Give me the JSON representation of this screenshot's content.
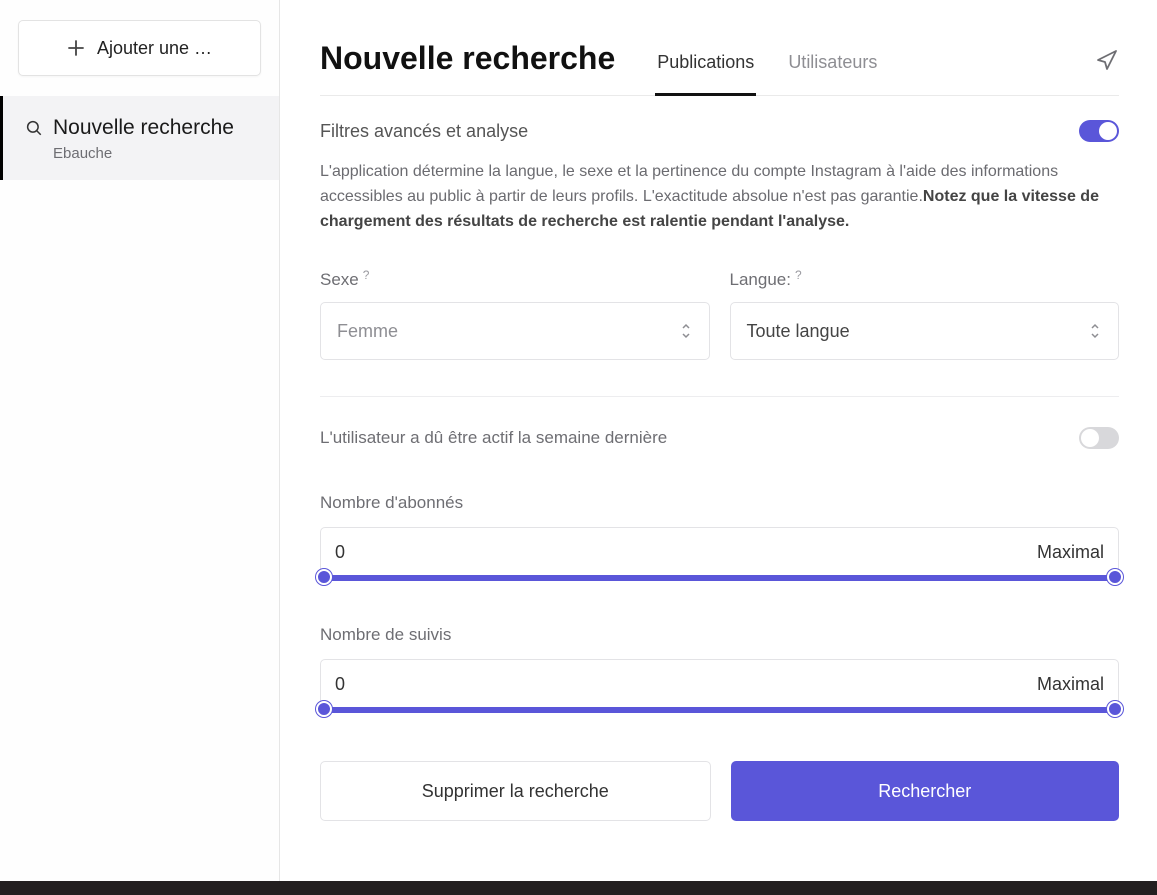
{
  "sidebar": {
    "add_label": "Ajouter une …",
    "item": {
      "title": "Nouvelle recherche",
      "subtitle": "Ebauche"
    }
  },
  "header": {
    "title": "Nouvelle recherche",
    "tabs": {
      "publications": "Publications",
      "users": "Utilisateurs"
    }
  },
  "filters": {
    "title": "Filtres avancés et analyse",
    "description_plain": "L'application détermine la langue, le sexe et la pertinence du compte Instagram à l'aide des informations accessibles au public à partir de leurs profils. L'exactitude absolue n'est pas garantie.",
    "description_bold": "Notez que la vitesse de chargement des résultats de recherche est ralentie pendant l'analyse.",
    "enabled": true
  },
  "fields": {
    "sex": {
      "label": "Sexe",
      "value": "Femme"
    },
    "language": {
      "label": "Langue:",
      "value": "Toute langue"
    }
  },
  "activity": {
    "label": "L'utilisateur a dû être actif la semaine dernière",
    "enabled": false
  },
  "followers": {
    "label": "Nombre d'abonnés",
    "min": "0",
    "max": "Maximal"
  },
  "following": {
    "label": "Nombre de suivis",
    "min": "0",
    "max": "Maximal"
  },
  "actions": {
    "delete": "Supprimer la recherche",
    "search": "Rechercher"
  }
}
